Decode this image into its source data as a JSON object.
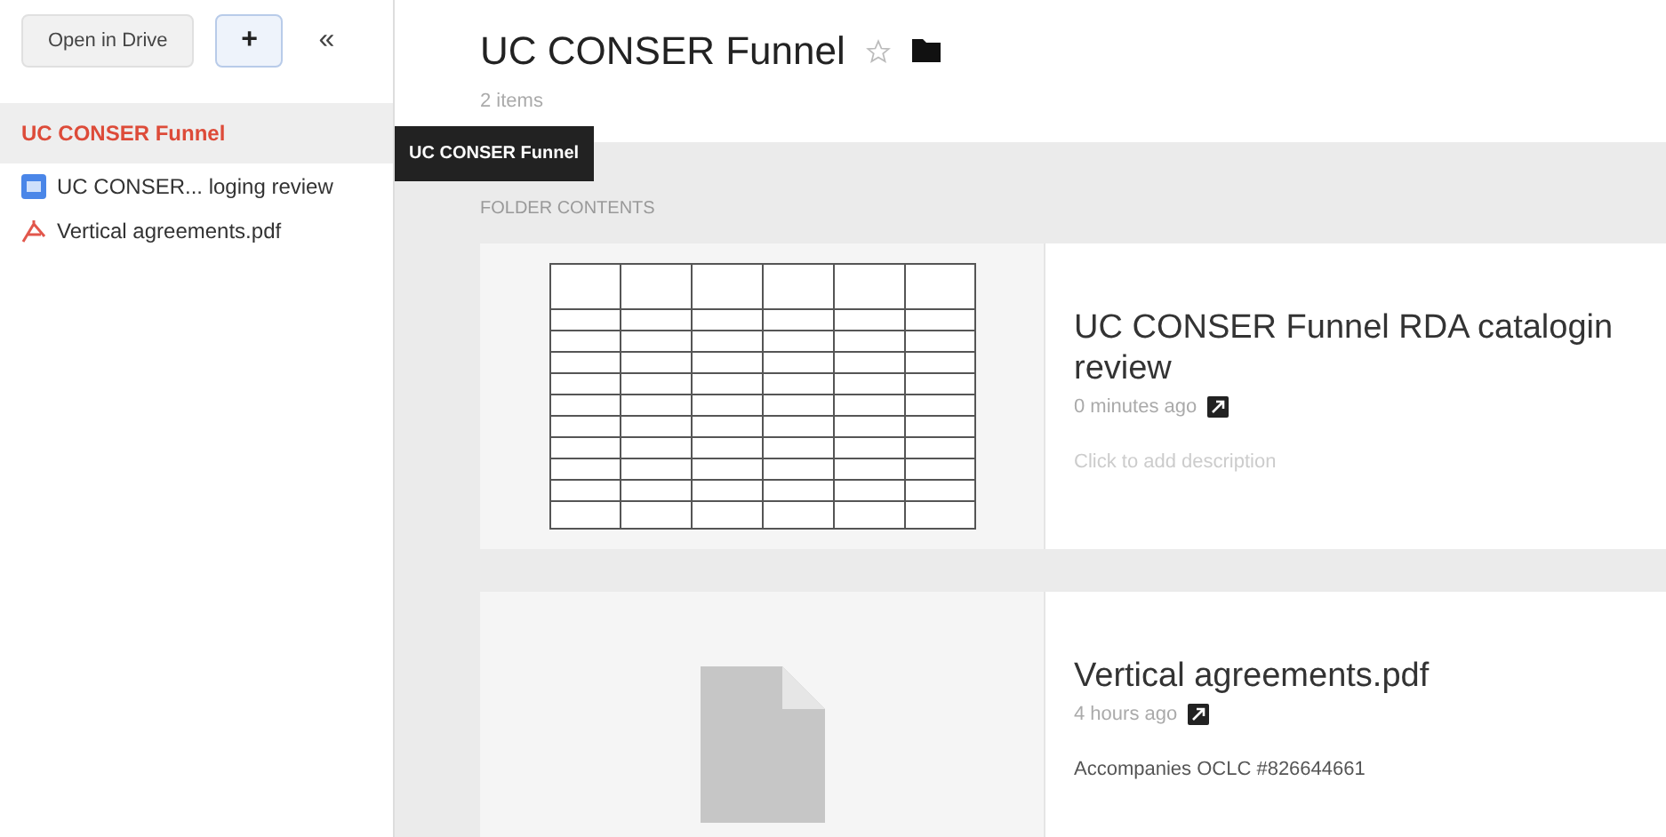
{
  "sidebar": {
    "open_button": "Open in Drive",
    "add_button": "+",
    "collapse_button": "«",
    "items": [
      {
        "kind": "folder",
        "label": "UC CONSER Funnel",
        "selected": true
      },
      {
        "kind": "doc",
        "label": "UC CONSER... loging review",
        "selected": false
      },
      {
        "kind": "pdf",
        "label": "Vertical agreements.pdf",
        "selected": false
      }
    ],
    "tooltip": "UC CONSER Funnel"
  },
  "header": {
    "title": "UC CONSER Funnel",
    "starred": false,
    "subtitle": "2 items"
  },
  "section_label": "FOLDER CONTENTS",
  "files": [
    {
      "kind": "doc",
      "title_lines": [
        "UC CONSER Funnel RDA catalogin",
        "review"
      ],
      "time": "0 minutes ago",
      "description": "Click to add description",
      "description_is_placeholder": true
    },
    {
      "kind": "pdf",
      "title_lines": [
        "Vertical agreements.pdf"
      ],
      "time": "4 hours ago",
      "description": "Accompanies OCLC #826644661",
      "description_is_placeholder": false
    }
  ]
}
